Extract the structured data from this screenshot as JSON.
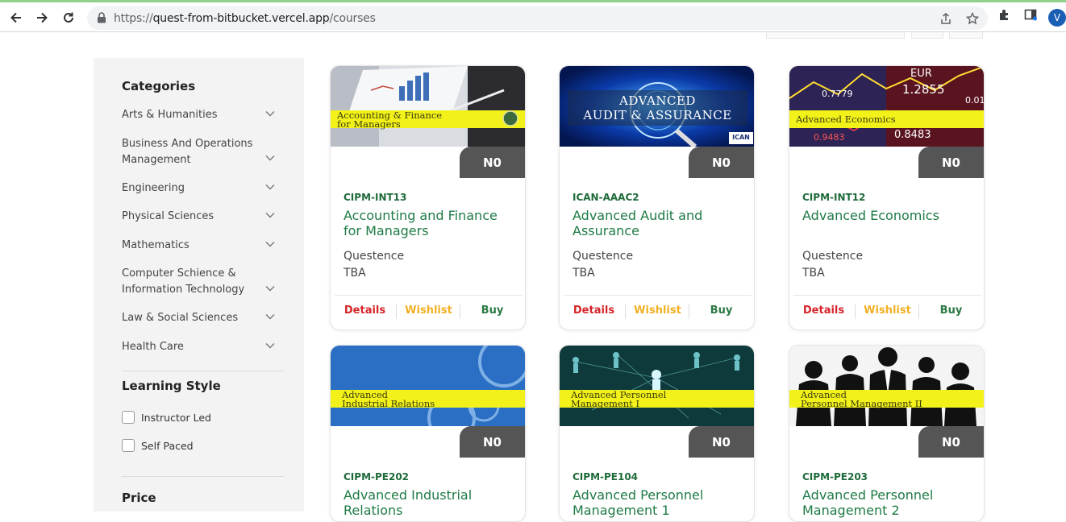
{
  "browser": {
    "url_prefix": "https://",
    "url_host": "quest-from-bitbucket.vercel.app",
    "url_path": "/courses",
    "avatar_letter": "V",
    "icons": [
      "back-icon",
      "forward-icon",
      "reload-icon",
      "lock-icon",
      "share-icon",
      "star-icon",
      "extensions-icon",
      "sidepanel-icon"
    ]
  },
  "sidebar": {
    "categories_heading": "Categories",
    "categories": [
      {
        "label": "Arts & Humanities"
      },
      {
        "label": "Business And Operations Management"
      },
      {
        "label": "Engineering"
      },
      {
        "label": "Physical Sciences"
      },
      {
        "label": "Mathematics"
      },
      {
        "label": "Computer Schience & Information Technology"
      },
      {
        "label": "Law & Social Sciences"
      },
      {
        "label": "Health Care"
      }
    ],
    "learning_style_heading": "Learning Style",
    "learning_styles": [
      {
        "label": "Instructor Led",
        "checked": false
      },
      {
        "label": "Self Paced",
        "checked": false
      }
    ],
    "price_heading": "Price"
  },
  "courses": [
    {
      "code": "CIPM-INT13",
      "title": "Accounting and Finance for Managers",
      "org": "Questence",
      "schedule": "TBA",
      "price": "N0",
      "banner": [
        "Accounting & Finance",
        "for Managers"
      ]
    },
    {
      "code": "ICAN-AAAC2",
      "title": "Advanced Audit and Assurance",
      "org": "Questence",
      "schedule": "TBA",
      "price": "N0",
      "banner": [
        "ADVANCED",
        "AUDIT & ASSURANCE"
      ],
      "badge": "ICAN"
    },
    {
      "code": "CIPM-INT12",
      "title": "Advanced Economics",
      "org": "Questence",
      "schedule": "TBA",
      "price": "N0",
      "banner": [
        "Advanced Economics"
      ],
      "ticker": [
        "EUR",
        "1.2855",
        "0.7779",
        "0.8483",
        "0.9483",
        "0.01"
      ]
    },
    {
      "code": "CIPM-PE202",
      "title": "Advanced Industrial Relations",
      "org": "Questence",
      "schedule": "TBA",
      "price": "N0",
      "banner": [
        "Advanced",
        "Industrial Relations"
      ]
    },
    {
      "code": "CIPM-PE104",
      "title": "Advanced Personnel Management 1",
      "org": "Questence",
      "schedule": "TBA",
      "price": "N0",
      "banner": [
        "Advanced Personnel",
        "Management I"
      ]
    },
    {
      "code": "CIPM-PE203",
      "title": "Advanced Personnel Management 2",
      "org": "Questence",
      "schedule": "TBA",
      "price": "N0",
      "banner": [
        "Advanced",
        "Personnel Management II"
      ]
    }
  ],
  "actions": {
    "details": "Details",
    "wishlist": "Wishlist",
    "buy": "Buy"
  },
  "colors": {
    "accent_green": "#1e7a44",
    "details_red": "#d6262a",
    "wishlist_gold": "#f2b024",
    "price_tag": "#555555",
    "banner_yellow": "#f2f21a"
  }
}
